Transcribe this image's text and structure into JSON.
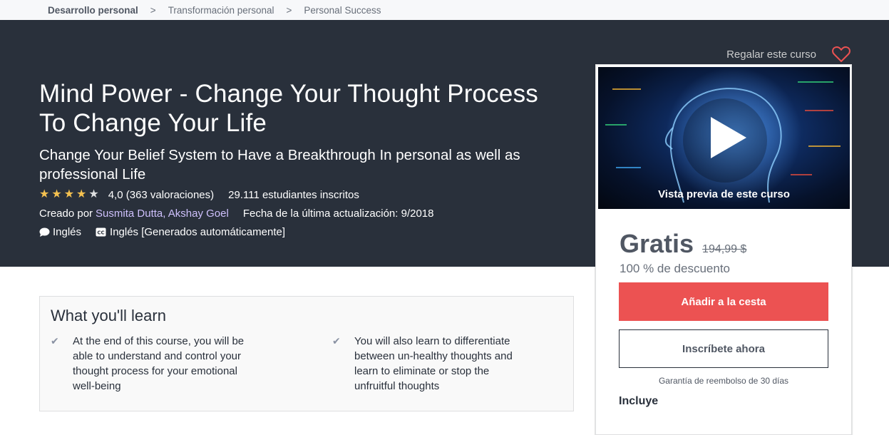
{
  "breadcrumb": {
    "items": [
      "Desarrollo personal",
      "Transformación personal",
      "Personal Success"
    ],
    "separator": ">"
  },
  "header": {
    "gift_label": "Regalar este curso",
    "title": "Mind Power - Change Your Thought Process To Change Your Life",
    "subtitle": "Change Your Belief System to Have a Breakthrough In personal as well as professional Life",
    "rating": {
      "value": 4.0,
      "stars_filled": 4,
      "stars_total": 5,
      "text": "4,0 (363 valoraciones)"
    },
    "enrolled": "29.111 estudiantes inscritos",
    "created_by_label": "Creado por",
    "authors": "Susmita Dutta, Akshay Goel",
    "updated": "Fecha de la última actualización: 9/2018",
    "language": "Inglés",
    "captions": "Inglés [Generados automáticamente]"
  },
  "sidebar": {
    "preview_label": "Vista previa de este curso",
    "price": "Gratis",
    "old_price": "194,99 $",
    "discount": "100 % de descuento",
    "cart_button": "Añadir a la cesta",
    "enroll_button": "Inscríbete ahora",
    "guarantee": "Garantía de reembolso de 30 días",
    "includes_title": "Incluye"
  },
  "learn": {
    "title": "What you'll learn",
    "items": [
      "At the end of this course, you will be able to understand and control your thought process for your emotional well-being",
      "You will also learn to differentiate between un-healthy thoughts and learn to eliminate or stop the unfruitful thoughts"
    ]
  },
  "colors": {
    "header_bg": "#29303b",
    "accent_red": "#ec5252",
    "star": "#f4c150",
    "author_link": "#cec0fc"
  },
  "icons": [
    "heart-icon",
    "star-icon",
    "speech-bubble-icon",
    "closed-captions-icon",
    "play-icon",
    "check-icon"
  ]
}
